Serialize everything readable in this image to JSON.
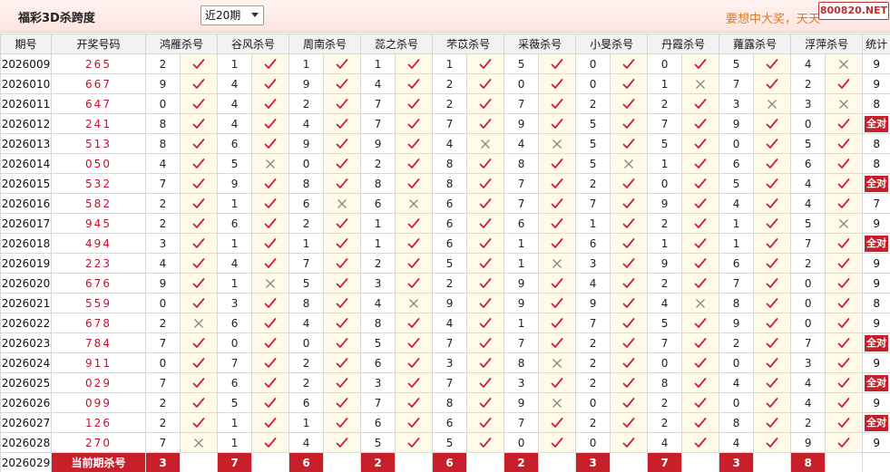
{
  "header": {
    "title": "福彩3D杀跨度",
    "period_select": "近20期",
    "slogan": "要想中大奖，天天",
    "watermark": "800820.NET"
  },
  "table": {
    "columns": [
      "期号",
      "开奖号码",
      "鸿雁杀号",
      "谷风杀号",
      "周南杀号",
      "蕊之杀号",
      "芣苡杀号",
      "采薇杀号",
      "小旻杀号",
      "丹霞杀号",
      "蕹露杀号",
      "浮萍杀号",
      "统计"
    ],
    "rows": [
      {
        "issue": "2026009",
        "draw": "265",
        "kills": [
          [
            "2",
            "y"
          ],
          [
            "1",
            "y"
          ],
          [
            "1",
            "y"
          ],
          [
            "1",
            "y"
          ],
          [
            "1",
            "y"
          ],
          [
            "5",
            "y"
          ],
          [
            "0",
            "y"
          ],
          [
            "0",
            "y"
          ],
          [
            "5",
            "y"
          ],
          [
            "4",
            "n"
          ]
        ],
        "stat": "9"
      },
      {
        "issue": "2026010",
        "draw": "667",
        "kills": [
          [
            "9",
            "y"
          ],
          [
            "4",
            "y"
          ],
          [
            "9",
            "y"
          ],
          [
            "4",
            "y"
          ],
          [
            "2",
            "y"
          ],
          [
            "0",
            "y"
          ],
          [
            "0",
            "y"
          ],
          [
            "1",
            "n"
          ],
          [
            "7",
            "y"
          ],
          [
            "2",
            "y"
          ]
        ],
        "stat": "9"
      },
      {
        "issue": "2026011",
        "draw": "647",
        "kills": [
          [
            "0",
            "y"
          ],
          [
            "4",
            "y"
          ],
          [
            "2",
            "y"
          ],
          [
            "7",
            "y"
          ],
          [
            "2",
            "y"
          ],
          [
            "7",
            "y"
          ],
          [
            "2",
            "y"
          ],
          [
            "2",
            "y"
          ],
          [
            "3",
            "n"
          ],
          [
            "3",
            "n"
          ]
        ],
        "stat": "8"
      },
      {
        "issue": "2026012",
        "draw": "241",
        "kills": [
          [
            "8",
            "y"
          ],
          [
            "4",
            "y"
          ],
          [
            "4",
            "y"
          ],
          [
            "7",
            "y"
          ],
          [
            "7",
            "y"
          ],
          [
            "9",
            "y"
          ],
          [
            "5",
            "y"
          ],
          [
            "7",
            "y"
          ],
          [
            "9",
            "y"
          ],
          [
            "0",
            "y"
          ]
        ],
        "stat": "全对"
      },
      {
        "issue": "2026013",
        "draw": "513",
        "kills": [
          [
            "8",
            "y"
          ],
          [
            "6",
            "y"
          ],
          [
            "9",
            "y"
          ],
          [
            "9",
            "y"
          ],
          [
            "4",
            "n"
          ],
          [
            "4",
            "n"
          ],
          [
            "5",
            "y"
          ],
          [
            "5",
            "y"
          ],
          [
            "0",
            "y"
          ],
          [
            "5",
            "y"
          ]
        ],
        "stat": "8"
      },
      {
        "issue": "2026014",
        "draw": "050",
        "kills": [
          [
            "4",
            "y"
          ],
          [
            "5",
            "n"
          ],
          [
            "0",
            "y"
          ],
          [
            "2",
            "y"
          ],
          [
            "8",
            "y"
          ],
          [
            "8",
            "y"
          ],
          [
            "5",
            "n"
          ],
          [
            "1",
            "y"
          ],
          [
            "6",
            "y"
          ],
          [
            "6",
            "y"
          ]
        ],
        "stat": "8"
      },
      {
        "issue": "2026015",
        "draw": "532",
        "kills": [
          [
            "7",
            "y"
          ],
          [
            "9",
            "y"
          ],
          [
            "8",
            "y"
          ],
          [
            "8",
            "y"
          ],
          [
            "8",
            "y"
          ],
          [
            "7",
            "y"
          ],
          [
            "2",
            "y"
          ],
          [
            "0",
            "y"
          ],
          [
            "5",
            "y"
          ],
          [
            "4",
            "y"
          ]
        ],
        "stat": "全对"
      },
      {
        "issue": "2026016",
        "draw": "582",
        "kills": [
          [
            "2",
            "y"
          ],
          [
            "1",
            "y"
          ],
          [
            "6",
            "n"
          ],
          [
            "6",
            "n"
          ],
          [
            "6",
            "y"
          ],
          [
            "7",
            "y"
          ],
          [
            "7",
            "y"
          ],
          [
            "9",
            "y"
          ],
          [
            "4",
            "y"
          ],
          [
            "4",
            "y"
          ]
        ],
        "stat": "7"
      },
      {
        "issue": "2026017",
        "draw": "945",
        "kills": [
          [
            "2",
            "y"
          ],
          [
            "6",
            "y"
          ],
          [
            "2",
            "y"
          ],
          [
            "1",
            "y"
          ],
          [
            "6",
            "y"
          ],
          [
            "6",
            "y"
          ],
          [
            "1",
            "y"
          ],
          [
            "2",
            "y"
          ],
          [
            "1",
            "y"
          ],
          [
            "5",
            "n"
          ]
        ],
        "stat": "9"
      },
      {
        "issue": "2026018",
        "draw": "494",
        "kills": [
          [
            "3",
            "y"
          ],
          [
            "1",
            "y"
          ],
          [
            "1",
            "y"
          ],
          [
            "1",
            "y"
          ],
          [
            "6",
            "y"
          ],
          [
            "1",
            "y"
          ],
          [
            "6",
            "y"
          ],
          [
            "1",
            "y"
          ],
          [
            "1",
            "y"
          ],
          [
            "7",
            "y"
          ]
        ],
        "stat": "全对"
      },
      {
        "issue": "2026019",
        "draw": "223",
        "kills": [
          [
            "4",
            "y"
          ],
          [
            "4",
            "y"
          ],
          [
            "7",
            "y"
          ],
          [
            "2",
            "y"
          ],
          [
            "5",
            "y"
          ],
          [
            "1",
            "n"
          ],
          [
            "3",
            "y"
          ],
          [
            "9",
            "y"
          ],
          [
            "6",
            "y"
          ],
          [
            "2",
            "y"
          ]
        ],
        "stat": "9"
      },
      {
        "issue": "2026020",
        "draw": "676",
        "kills": [
          [
            "9",
            "y"
          ],
          [
            "1",
            "n"
          ],
          [
            "5",
            "y"
          ],
          [
            "3",
            "y"
          ],
          [
            "2",
            "y"
          ],
          [
            "9",
            "y"
          ],
          [
            "4",
            "y"
          ],
          [
            "2",
            "y"
          ],
          [
            "7",
            "y"
          ],
          [
            "0",
            "y"
          ]
        ],
        "stat": "9"
      },
      {
        "issue": "2026021",
        "draw": "559",
        "kills": [
          [
            "0",
            "y"
          ],
          [
            "3",
            "y"
          ],
          [
            "8",
            "y"
          ],
          [
            "4",
            "n"
          ],
          [
            "9",
            "y"
          ],
          [
            "9",
            "y"
          ],
          [
            "9",
            "y"
          ],
          [
            "4",
            "n"
          ],
          [
            "8",
            "y"
          ],
          [
            "0",
            "y"
          ]
        ],
        "stat": "8"
      },
      {
        "issue": "2026022",
        "draw": "678",
        "kills": [
          [
            "2",
            "n"
          ],
          [
            "6",
            "y"
          ],
          [
            "4",
            "y"
          ],
          [
            "8",
            "y"
          ],
          [
            "4",
            "y"
          ],
          [
            "1",
            "y"
          ],
          [
            "7",
            "y"
          ],
          [
            "5",
            "y"
          ],
          [
            "9",
            "y"
          ],
          [
            "0",
            "y"
          ]
        ],
        "stat": "9"
      },
      {
        "issue": "2026023",
        "draw": "784",
        "kills": [
          [
            "7",
            "y"
          ],
          [
            "0",
            "y"
          ],
          [
            "0",
            "y"
          ],
          [
            "5",
            "y"
          ],
          [
            "7",
            "y"
          ],
          [
            "7",
            "y"
          ],
          [
            "2",
            "y"
          ],
          [
            "7",
            "y"
          ],
          [
            "2",
            "y"
          ],
          [
            "7",
            "y"
          ]
        ],
        "stat": "全对"
      },
      {
        "issue": "2026024",
        "draw": "911",
        "kills": [
          [
            "0",
            "y"
          ],
          [
            "7",
            "y"
          ],
          [
            "2",
            "y"
          ],
          [
            "6",
            "y"
          ],
          [
            "3",
            "y"
          ],
          [
            "8",
            "n"
          ],
          [
            "2",
            "y"
          ],
          [
            "0",
            "y"
          ],
          [
            "0",
            "y"
          ],
          [
            "3",
            "y"
          ]
        ],
        "stat": "9"
      },
      {
        "issue": "2026025",
        "draw": "029",
        "kills": [
          [
            "7",
            "y"
          ],
          [
            "6",
            "y"
          ],
          [
            "2",
            "y"
          ],
          [
            "3",
            "y"
          ],
          [
            "7",
            "y"
          ],
          [
            "3",
            "y"
          ],
          [
            "2",
            "y"
          ],
          [
            "8",
            "y"
          ],
          [
            "4",
            "y"
          ],
          [
            "4",
            "y"
          ]
        ],
        "stat": "全对"
      },
      {
        "issue": "2026026",
        "draw": "099",
        "kills": [
          [
            "2",
            "y"
          ],
          [
            "5",
            "y"
          ],
          [
            "6",
            "y"
          ],
          [
            "7",
            "y"
          ],
          [
            "8",
            "y"
          ],
          [
            "9",
            "n"
          ],
          [
            "0",
            "y"
          ],
          [
            "2",
            "y"
          ],
          [
            "0",
            "y"
          ],
          [
            "4",
            "y"
          ]
        ],
        "stat": "9"
      },
      {
        "issue": "2026027",
        "draw": "126",
        "kills": [
          [
            "2",
            "y"
          ],
          [
            "1",
            "y"
          ],
          [
            "1",
            "y"
          ],
          [
            "6",
            "y"
          ],
          [
            "6",
            "y"
          ],
          [
            "7",
            "y"
          ],
          [
            "2",
            "y"
          ],
          [
            "2",
            "y"
          ],
          [
            "8",
            "y"
          ],
          [
            "2",
            "y"
          ]
        ],
        "stat": "全对"
      },
      {
        "issue": "2026028",
        "draw": "270",
        "kills": [
          [
            "7",
            "n"
          ],
          [
            "1",
            "y"
          ],
          [
            "4",
            "y"
          ],
          [
            "5",
            "y"
          ],
          [
            "5",
            "y"
          ],
          [
            "0",
            "y"
          ],
          [
            "0",
            "y"
          ],
          [
            "4",
            "y"
          ],
          [
            "4",
            "y"
          ],
          [
            "9",
            "y"
          ]
        ],
        "stat": "9"
      }
    ],
    "current": {
      "issue": "2026029",
      "label": "当前期杀号",
      "kills": [
        "3",
        "7",
        "6",
        "2",
        "6",
        "2",
        "3",
        "7",
        "3",
        "8"
      ]
    }
  },
  "colors": {
    "draw_red": "#c8102e",
    "badge_red": "#c8202a",
    "check": "#d0202e",
    "cross": "#888888",
    "mark_bg": "#fffbe8"
  },
  "icons": {
    "hit": "check-icon",
    "miss": "cross-icon"
  }
}
